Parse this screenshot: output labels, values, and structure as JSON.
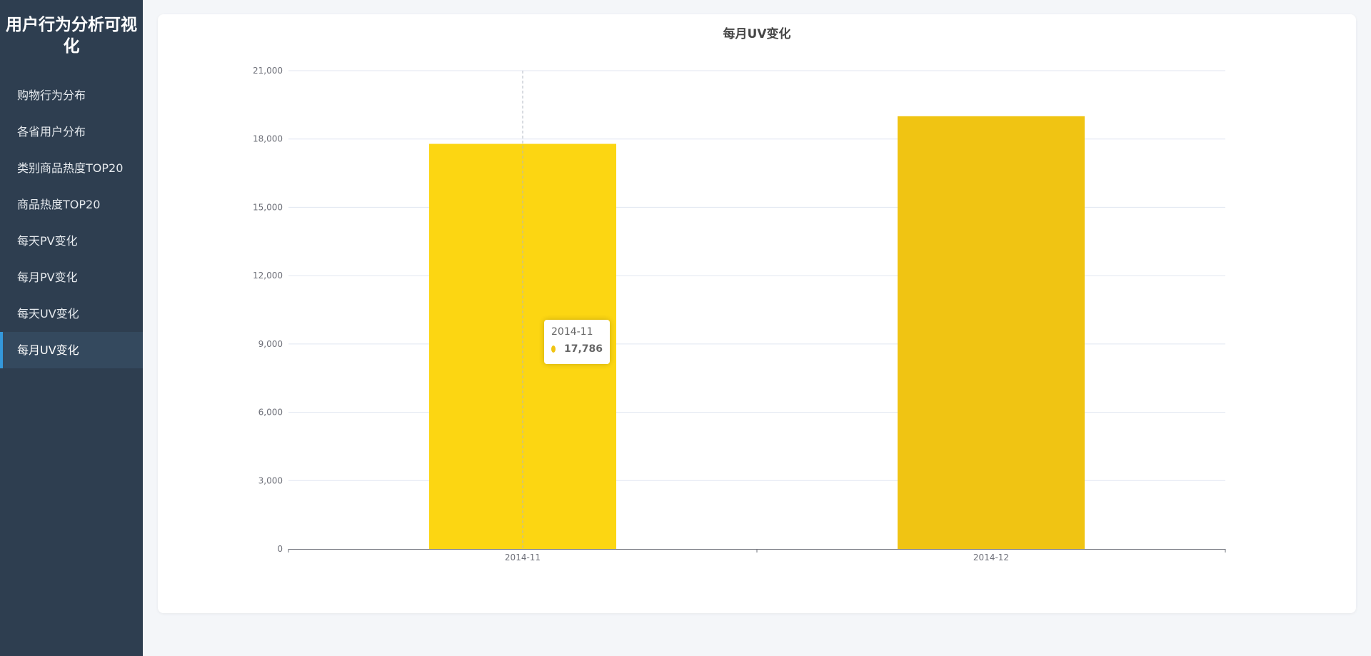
{
  "sidebar": {
    "title": "用户行为分析可视化",
    "items": [
      {
        "label": "购物行为分布",
        "active": false
      },
      {
        "label": "各省用户分布",
        "active": false
      },
      {
        "label": "类别商品热度TOP20",
        "active": false
      },
      {
        "label": "商品热度TOP20",
        "active": false
      },
      {
        "label": "每天PV变化",
        "active": false
      },
      {
        "label": "每月PV变化",
        "active": false
      },
      {
        "label": "每天UV变化",
        "active": false
      },
      {
        "label": "每月UV变化",
        "active": true
      }
    ]
  },
  "chart_data": {
    "type": "bar",
    "title": "每月UV变化",
    "categories": [
      "2014-11",
      "2014-12"
    ],
    "values": [
      17786,
      19000
    ],
    "bar_colors": [
      "#fcd612",
      "#f0c413"
    ],
    "ylim": [
      0,
      21000
    ],
    "yticks": [
      0,
      3000,
      6000,
      9000,
      12000,
      15000,
      18000,
      21000
    ],
    "ytick_labels": [
      "0",
      "3,000",
      "6,000",
      "9,000",
      "12,000",
      "15,000",
      "18,000",
      "21,000"
    ],
    "grid": true,
    "xlabel": "",
    "ylabel": ""
  },
  "tooltip": {
    "category": "2014-11",
    "value": "17,786",
    "color": "#f0c413"
  }
}
